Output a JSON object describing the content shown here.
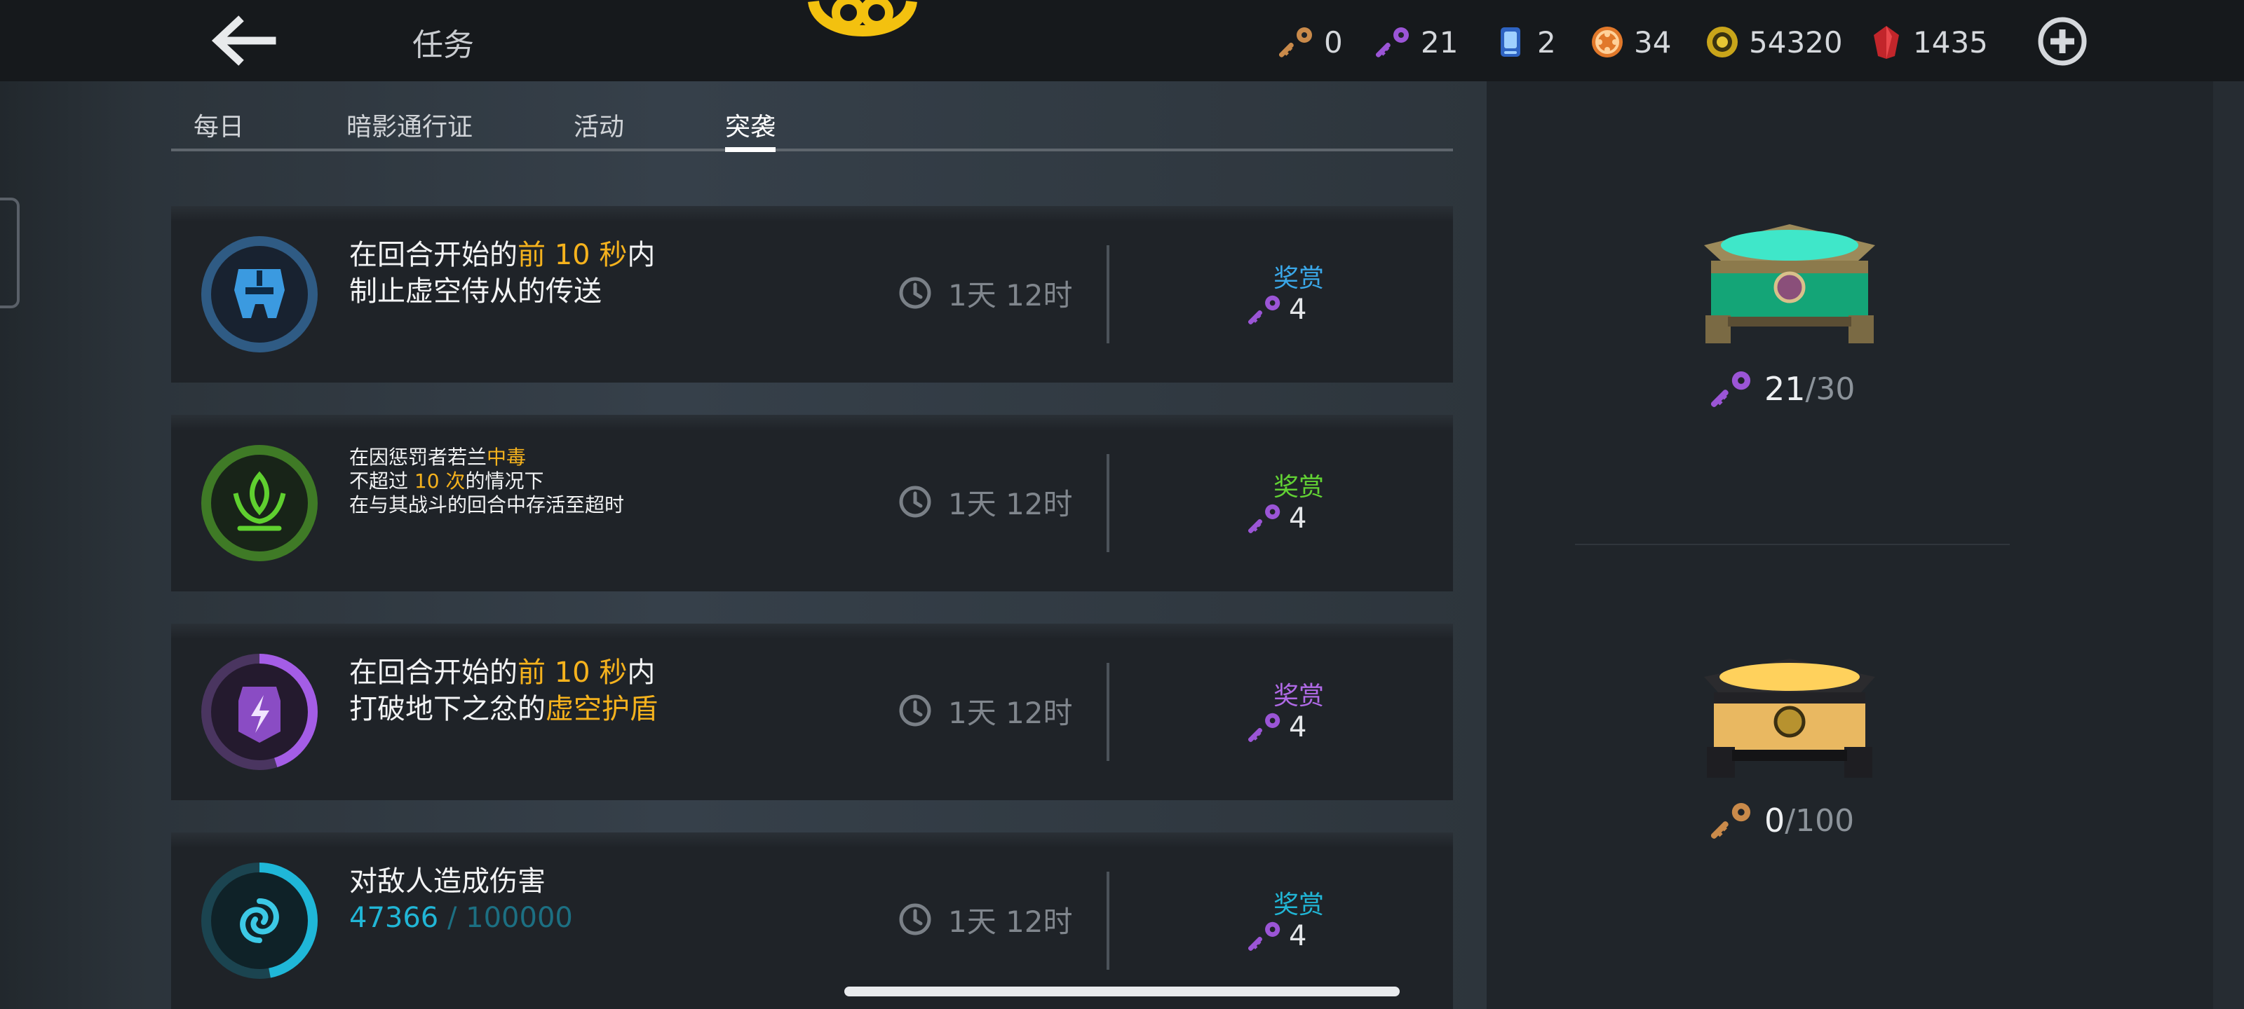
{
  "header": {
    "title": "任务",
    "currencies": [
      {
        "icon": "bronze-key-icon",
        "value": "0"
      },
      {
        "icon": "purple-key-icon",
        "value": "21"
      },
      {
        "icon": "card-icon",
        "value": "2"
      },
      {
        "icon": "orange-token-icon",
        "value": "34"
      },
      {
        "icon": "gold-coin-icon",
        "value": "54320"
      },
      {
        "icon": "red-gem-icon",
        "value": "1435"
      }
    ]
  },
  "tabs": [
    {
      "label": "每日",
      "active": false
    },
    {
      "label": "暗影通行证",
      "active": false
    },
    {
      "label": "活动",
      "active": false
    },
    {
      "label": "突袭",
      "active": true
    }
  ],
  "quests": [
    {
      "icon": "robot-mask-icon",
      "ring_color": "#2f75b0",
      "ring_progress": 0.0,
      "line1_pre": "在回合开始的",
      "line1_hl": "前 10 秒",
      "line1_post": "内",
      "line2_pre": "制止虚空侍从的传送",
      "line2_hl": "",
      "timer": "1天 12时",
      "reward_label": "奖赏",
      "reward_label_color": "#3aa7e8",
      "reward_value": "4"
    },
    {
      "icon": "lotus-icon",
      "ring_color": "#4c9a2e",
      "ring_progress": 0.0,
      "line1_pre": "在因惩罚者若兰",
      "line1_hl": "中毒",
      "line1_post": "",
      "line2_pre": "不超过 ",
      "line2_hl": "10 次",
      "line2_post": "的情况下",
      "line3": "在与其战斗的回合中存活至超时",
      "timer": "1天 12时",
      "reward_label": "奖赏",
      "reward_label_color": "#62d234",
      "reward_value": "4"
    },
    {
      "icon": "void-shield-icon",
      "ring_color": "#9a52d8",
      "ring_progress": 0.45,
      "line1_pre": "在回合开始的",
      "line1_hl": "前 10 秒",
      "line1_post": "内",
      "line2_pre": "打破地下之忿的",
      "line2_hl": "虚空护盾",
      "timer": "1天 12时",
      "reward_label": "奖赏",
      "reward_label_color": "#b06ae6",
      "reward_value": "4"
    },
    {
      "icon": "vortex-icon",
      "ring_color": "#18b4d4",
      "ring_progress": 0.47,
      "line1_pre": "对敌人造成伤害",
      "line1_hl": "",
      "line1_post": "",
      "progress_current": "47366",
      "progress_sep": " / ",
      "progress_max": "100000",
      "timer": "1天 12时",
      "reward_label": "奖赏",
      "reward_label_color": "#21b6d6",
      "reward_value": "4"
    }
  ],
  "chests": [
    {
      "name": "purple-key-chest",
      "current": "21",
      "sep": " / ",
      "max": "30",
      "key_icon": "purple-key-icon"
    },
    {
      "name": "bronze-key-chest",
      "current": "0",
      "sep": " / ",
      "max": "100",
      "key_icon": "bronze-key-icon"
    }
  ],
  "colors": {
    "highlight": "#f5b21d",
    "purple_key": "#9b55d6",
    "bronze_key": "#c98a4a"
  }
}
